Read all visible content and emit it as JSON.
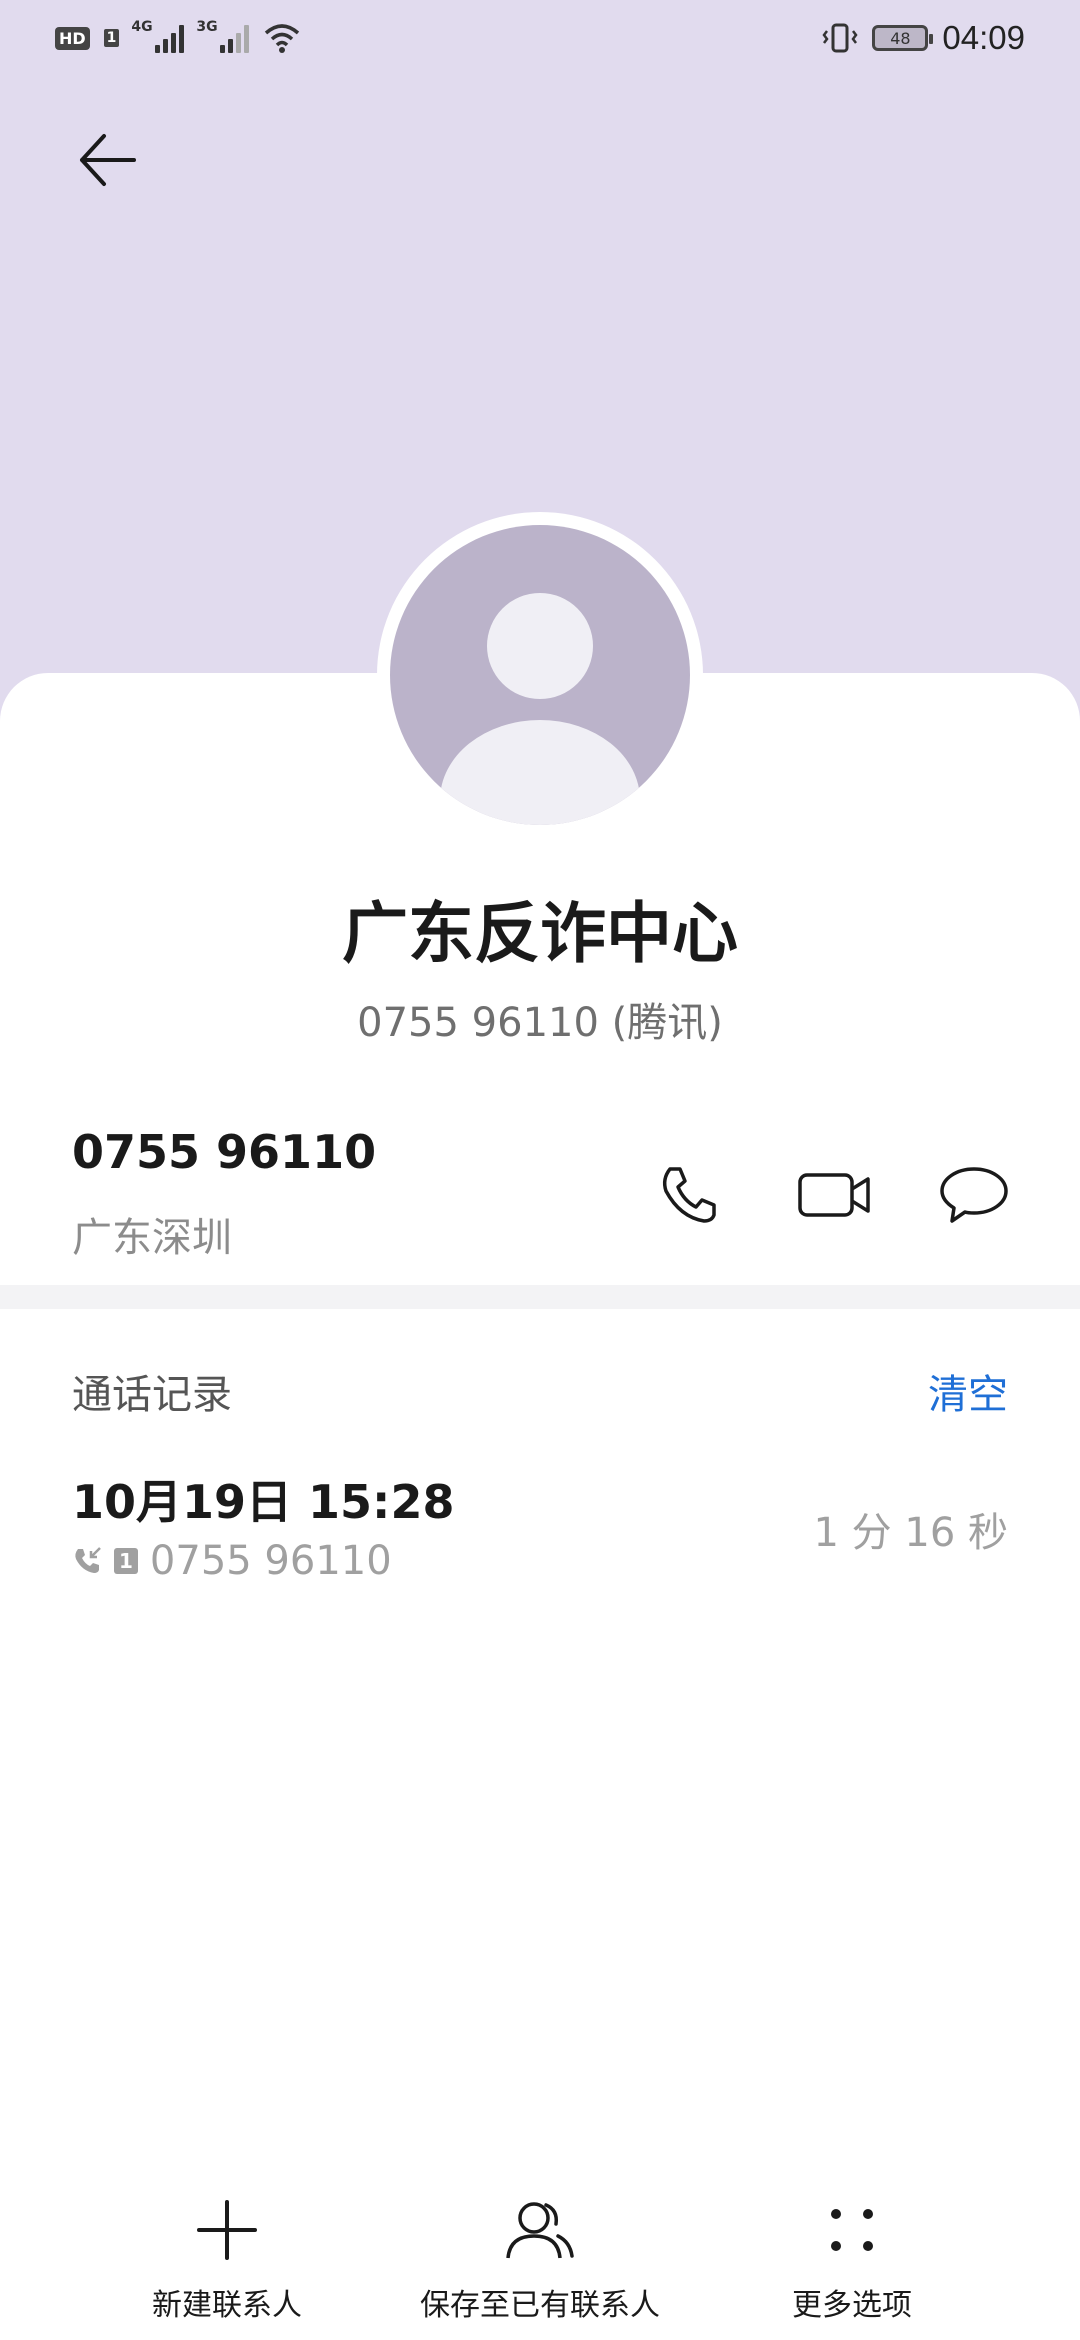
{
  "status_bar": {
    "time": "04:09",
    "battery": "48",
    "hd_label": "HD",
    "sim_label": "1",
    "network_1": "4G",
    "network_2": "3G"
  },
  "contact": {
    "name": "广东反诈中心",
    "subtitle": "0755 96110 (腾讯)",
    "number": "0755 96110",
    "location": "广东深圳"
  },
  "call_history": {
    "title": "通话记录",
    "clear_label": "清空",
    "items": [
      {
        "date": "10月19日 15:28",
        "sim": "1",
        "number": "0755 96110",
        "duration": "1 分 16 秒"
      }
    ]
  },
  "bottom_bar": {
    "new_contact": "新建联系人",
    "save_existing": "保存至已有联系人",
    "more": "更多选项"
  },
  "icons": {
    "back": "arrow-left-icon",
    "call": "phone-icon",
    "video": "video-camera-icon",
    "message": "chat-bubble-icon",
    "add": "plus-icon",
    "person": "person-icon",
    "more": "dots-icon"
  },
  "colors": {
    "header_bg": "#e1dbee",
    "avatar_bg": "#bbb3ca",
    "accent": "#1f6fd6"
  }
}
